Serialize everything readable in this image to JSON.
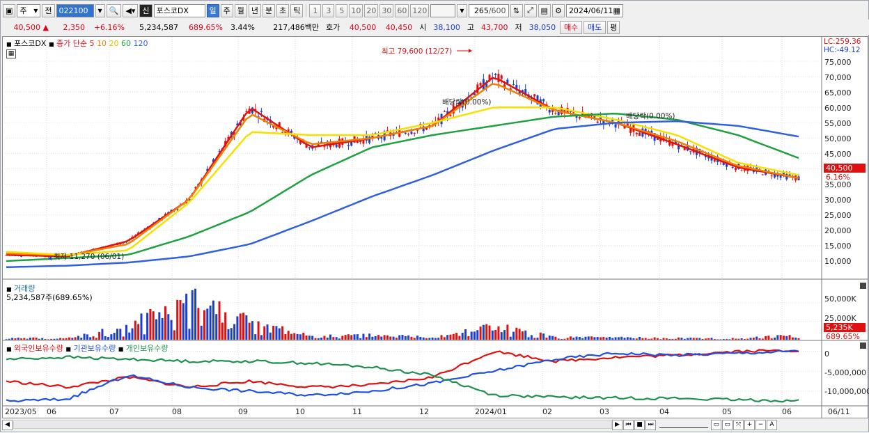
{
  "toolbar1": {
    "period_select": "주",
    "prev_label": "전",
    "stock_code": "022100",
    "stock_badge": "신",
    "stock_name": "포스코DX",
    "period_tabs": [
      "일",
      "주",
      "월",
      "년",
      "분",
      "초",
      "틱"
    ],
    "selected_tab": "일",
    "interval_buttons": [
      "1",
      "3",
      "5",
      "10",
      "20",
      "30",
      "60",
      "120"
    ],
    "count": "265",
    "count_total": "/600",
    "date": "2024/06/11"
  },
  "toolbar2": {
    "price": "40,500",
    "change_arrow": "▲",
    "change": "2,350",
    "change_pct": "+6.16%",
    "volume": "5,234,587",
    "volume_pct": "689.65%",
    "turnover": "3.44%",
    "amount": "217,486백만",
    "quote_label": "호가",
    "ask": "40,500",
    "bid": "40,450",
    "open_label": "시",
    "open": "38,100",
    "high_label": "고",
    "high": "43,700",
    "low_label": "저",
    "low": "38,050",
    "buy_label": "매수",
    "sell_label": "매도",
    "flat_label": "평"
  },
  "price_panel": {
    "stock_label": "포스코DX",
    "ma_label": "종가 단순",
    "ma_periods": [
      "5",
      "10",
      "20",
      "60",
      "120"
    ],
    "ma_colors": [
      "#e01010",
      "#f08000",
      "#f5e000",
      "#20a040",
      "#3060e0"
    ],
    "high_note": "최고 79,600 (12/27)",
    "low_note": "최저 11,270 (06/01)",
    "div_note_1": "배당락(0.00%)",
    "div_note_2": "배당락(0.00%)",
    "lc": "LC:259.36",
    "hc": "HC:-49.12",
    "last_price_tag": "40,500",
    "last_pct_tag": "6.16%"
  },
  "volume_panel": {
    "title": "거래량",
    "value": "5,234,587주(689.65%)",
    "tag_volume": "5,235K",
    "tag_pct": "689.65%"
  },
  "holding_panel": {
    "series": [
      "외국인보유수량",
      "기관보유수량",
      "개인보유수량"
    ],
    "colors": [
      "#e01010",
      "#2050e0",
      "#209050"
    ]
  },
  "price_yaxis": [
    "75,000",
    "70,000",
    "65,000",
    "60,000",
    "55,000",
    "50,000",
    "45,000",
    "40,000",
    "35,000",
    "30,000",
    "25,000",
    "20,000",
    "15,000",
    "10,000"
  ],
  "volume_yaxis": [
    "50,000K",
    "25,000K"
  ],
  "holding_yaxis": [
    "0",
    "-5,000,000",
    "-10,000,000"
  ],
  "xaxis": [
    "2023/05",
    "06",
    "07",
    "08",
    "09",
    "10",
    "11",
    "12",
    "2024/01",
    "02",
    "03",
    "04",
    "05",
    "06",
    "06/11"
  ],
  "chart_data": [
    {
      "type": "line",
      "title": "포스코DX",
      "ylim": [
        5000,
        82000
      ],
      "x": [
        "2023/05",
        "06",
        "07",
        "08",
        "09",
        "10",
        "11",
        "12",
        "2024/01",
        "02",
        "03",
        "04",
        "05",
        "06"
      ],
      "series": [
        {
          "name": "5",
          "values": [
            12000,
            11500,
            16500,
            30000,
            60000,
            47000,
            50000,
            54000,
            70000,
            59000,
            55000,
            48000,
            40500,
            37000
          ]
        },
        {
          "name": "10",
          "values": [
            12500,
            11800,
            15500,
            30000,
            58000,
            48000,
            50000,
            54000,
            68000,
            59000,
            55000,
            49000,
            41000,
            37000
          ]
        },
        {
          "name": "20",
          "values": [
            13000,
            12000,
            13500,
            29000,
            52000,
            51000,
            51000,
            55000,
            60000,
            60000,
            56000,
            51000,
            42000,
            38000
          ]
        },
        {
          "name": "60",
          "values": [
            10000,
            11000,
            12000,
            18000,
            26000,
            38000,
            47000,
            51000,
            54000,
            57000,
            58000,
            56000,
            51000,
            43500
          ]
        },
        {
          "name": "120",
          "values": [
            8000,
            8500,
            9500,
            11500,
            15500,
            23000,
            31000,
            38000,
            46000,
            53000,
            55000,
            55500,
            54000,
            50500
          ]
        }
      ]
    },
    {
      "type": "bar",
      "title": "거래량",
      "ylim": [
        0,
        80000
      ],
      "x": [
        "2023/05",
        "06",
        "07",
        "08",
        "09",
        "10",
        "11",
        "12",
        "2024/01",
        "02",
        "03",
        "04",
        "05",
        "06"
      ],
      "values": [
        2000,
        1500,
        15000,
        45000,
        20000,
        4000,
        5000,
        3000,
        15000,
        3000,
        2500,
        2000,
        1500,
        5235
      ]
    },
    {
      "type": "line",
      "ylim": [
        -13500000,
        2000000
      ],
      "x": [
        "2023/05",
        "06",
        "07",
        "08",
        "09",
        "10",
        "11",
        "12",
        "2024/01",
        "02",
        "03",
        "04",
        "05",
        "06"
      ],
      "series": [
        {
          "name": "외국인보유수량",
          "values": [
            -7500000,
            -9000000,
            -6500000,
            -9000000,
            -7500000,
            -9000000,
            -8500000,
            -6500000,
            0,
            -2500000,
            -1500000,
            -1000000,
            0,
            200000
          ]
        },
        {
          "name": "기관보유수량",
          "values": [
            -12500000,
            -12000000,
            -6000000,
            -9000000,
            -10000000,
            -11000000,
            -10000000,
            -8000000,
            -5000000,
            -2000000,
            -500000,
            -1000000,
            -500000,
            0
          ]
        },
        {
          "name": "개인보유수량",
          "values": [
            -2000000,
            -1500000,
            -2000000,
            -2500000,
            -2500000,
            -3000000,
            -4000000,
            -6000000,
            -11000000,
            -11500000,
            -11700000,
            -11800000,
            -12200000,
            -12400000
          ]
        }
      ]
    }
  ]
}
